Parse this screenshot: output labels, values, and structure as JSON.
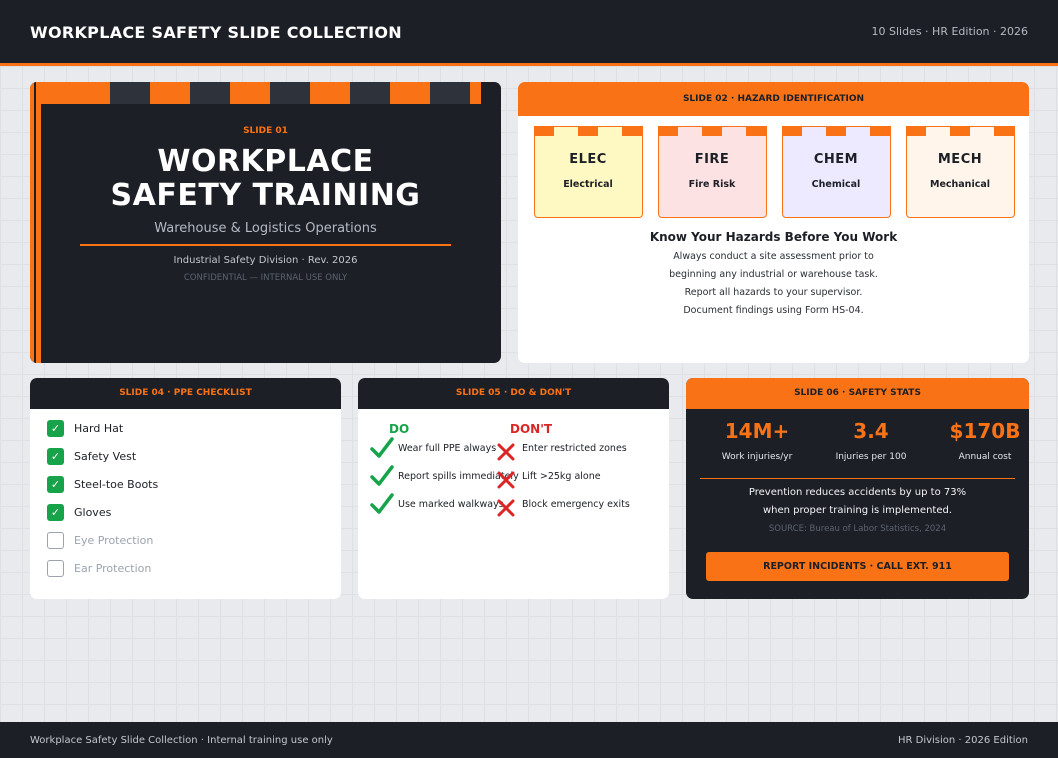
{
  "header": {
    "title": "WORKPLACE SAFETY SLIDE COLLECTION",
    "meta": "10 Slides · HR Edition · 2026"
  },
  "slide01": {
    "kicker": "SLIDE 01",
    "title_line1": "WORKPLACE",
    "title_line2": "SAFETY TRAINING",
    "subtitle": "Warehouse & Logistics Operations",
    "division": "Industrial Safety Division · Rev. 2026",
    "confidential": "CONFIDENTIAL — INTERNAL USE ONLY"
  },
  "slide02": {
    "header": "SLIDE 02 · HAZARD IDENTIFICATION",
    "hazards": [
      {
        "code": "ELEC",
        "name": "Electrical",
        "bg": "#fef9c3"
      },
      {
        "code": "FIRE",
        "name": "Fire Risk",
        "bg": "#fde2e4"
      },
      {
        "code": "CHEM",
        "name": "Chemical",
        "bg": "#ede9fe"
      },
      {
        "code": "MECH",
        "name": "Mechanical",
        "bg": "#fff5eb"
      }
    ],
    "heading": "Know Your Hazards Before You Work",
    "lines": [
      "Always conduct a site assessment prior to",
      "beginning any industrial or warehouse task.",
      "Report all hazards to your supervisor.",
      "Document findings using Form HS-04."
    ]
  },
  "slide04": {
    "header": "SLIDE 04 · PPE CHECKLIST",
    "items": [
      {
        "label": "Hard Hat",
        "checked": true
      },
      {
        "label": "Safety Vest",
        "checked": true
      },
      {
        "label": "Steel-toe Boots",
        "checked": true
      },
      {
        "label": "Gloves",
        "checked": true
      },
      {
        "label": "Eye Protection",
        "checked": false
      },
      {
        "label": "Ear Protection",
        "checked": false
      }
    ]
  },
  "slide05": {
    "header": "SLIDE 05 · DO & DON'T",
    "do_label": "DO",
    "dont_label": "DON'T",
    "dos": [
      "Wear full PPE always",
      "Report spills immediately",
      "Use marked walkways"
    ],
    "donts": [
      "Enter restricted zones",
      "Lift >25kg alone",
      "Block emergency exits"
    ]
  },
  "slide06": {
    "header": "SLIDE 06 · SAFETY STATS",
    "stats": [
      {
        "value": "14M+",
        "label": "Work injuries/yr"
      },
      {
        "value": "3.4",
        "label": "Injuries per 100"
      },
      {
        "value": "$170B",
        "label": "Annual cost"
      }
    ],
    "line1": "Prevention reduces accidents by up to 73%",
    "line2": "when proper training is implemented.",
    "source": "SOURCE: Bureau of Labor Statistics, 2024",
    "button": "REPORT INCIDENTS · CALL EXT. 911"
  },
  "footer": {
    "left": "Workplace Safety Slide Collection · Internal training use only",
    "right": "HR Division · 2026 Edition"
  },
  "colors": {
    "accent": "#f97316",
    "dark": "#1c1f26",
    "success": "#16a34a",
    "danger": "#dc2626"
  }
}
